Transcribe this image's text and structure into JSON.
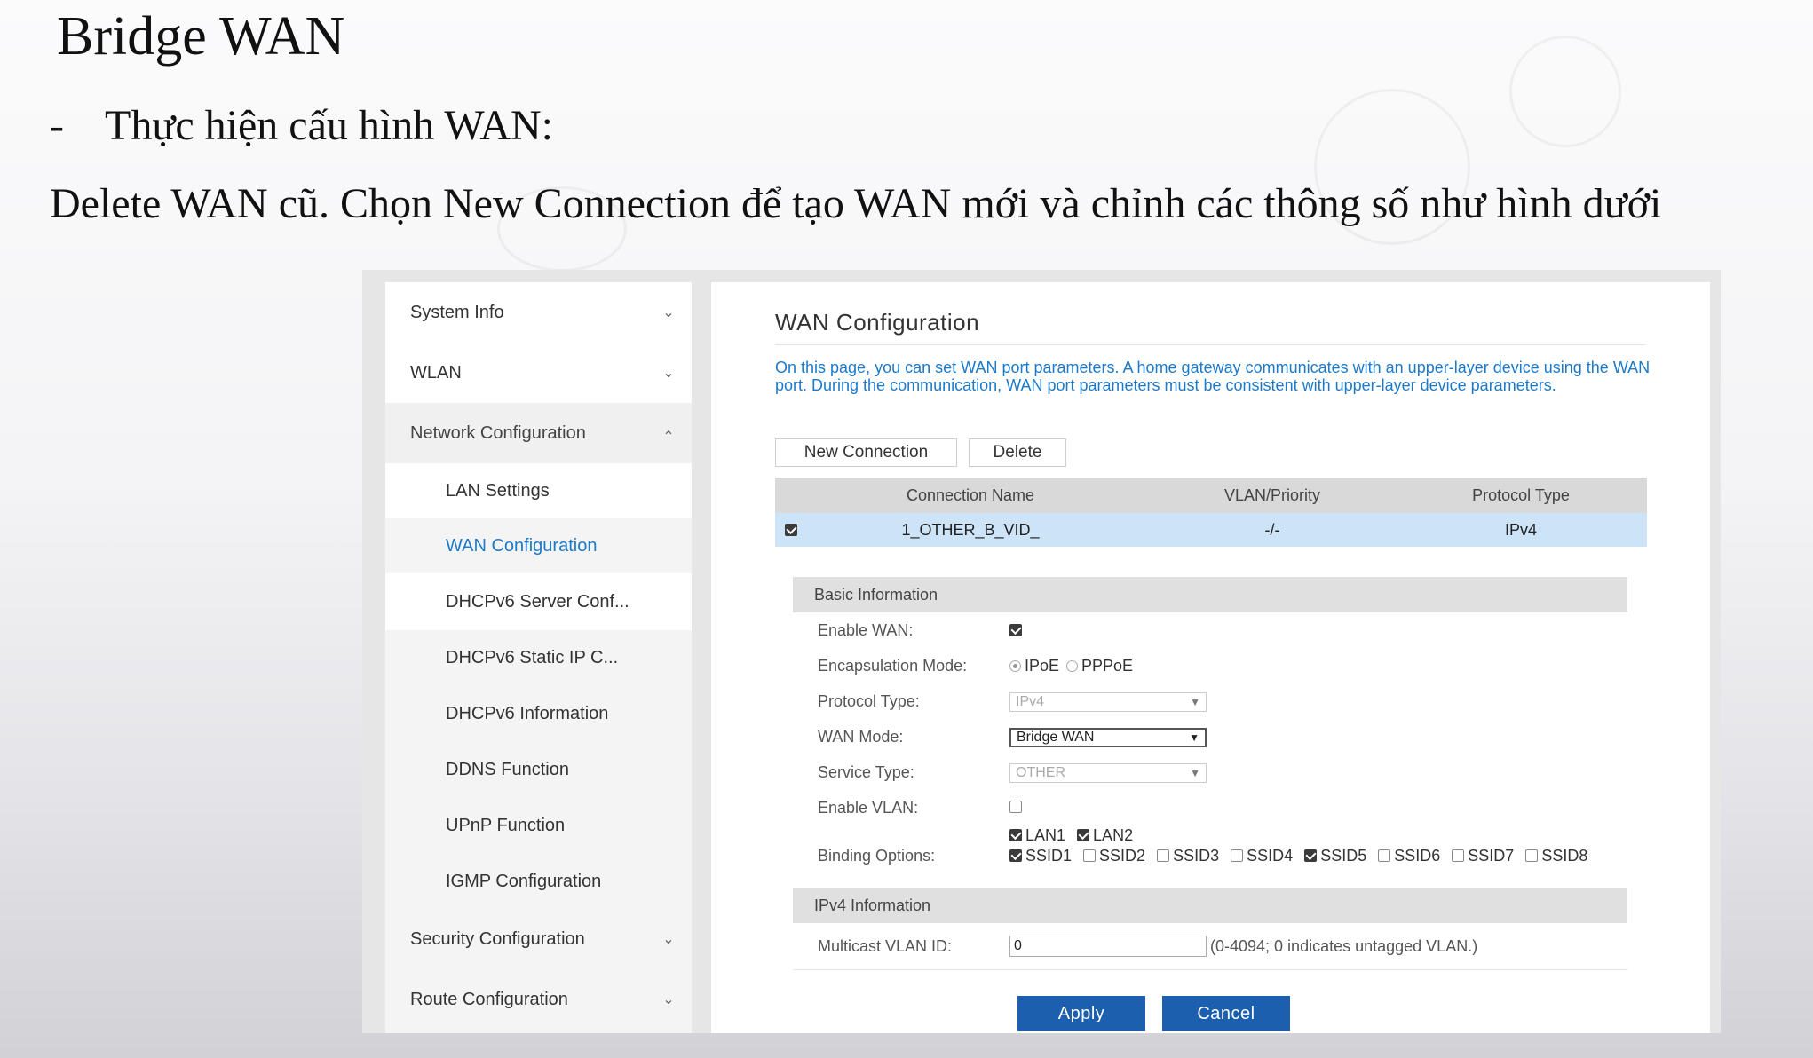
{
  "slide": {
    "title": "Bridge WAN",
    "bullet": {
      "marker": "-",
      "text": "Thực hiện cấu hình WAN:"
    },
    "description": "Delete WAN cũ. Chọn New Connection để tạo WAN mới và chỉnh các thông số như hình dưới"
  },
  "sidebar": {
    "items": [
      {
        "label": "System Info"
      },
      {
        "label": "WLAN"
      },
      {
        "label": "Network Configuration"
      },
      {
        "label": "LAN Settings"
      },
      {
        "label": "WAN Configuration"
      },
      {
        "label": "DHCPv6 Server Conf..."
      },
      {
        "label": "DHCPv6 Static IP C..."
      },
      {
        "label": "DHCPv6 Information"
      },
      {
        "label": "DDNS Function"
      },
      {
        "label": "UPnP Function"
      },
      {
        "label": "IGMP Configuration"
      },
      {
        "label": "Security Configuration"
      },
      {
        "label": "Route Configuration"
      }
    ]
  },
  "main": {
    "title": "WAN Configuration",
    "intro": "On this page, you can set WAN port parameters. A home gateway communicates with an upper-layer device using the WAN port. During the communication, WAN port parameters must be consistent with upper-layer device parameters.",
    "buttons": {
      "new_connection": "New Connection",
      "delete": "Delete"
    },
    "table": {
      "headers": [
        "Connection Name",
        "VLAN/Priority",
        "Protocol Type"
      ],
      "rows": [
        {
          "selected": true,
          "name": "1_OTHER_B_VID_",
          "vlan": "-/-",
          "protocol": "IPv4"
        }
      ]
    },
    "basic": {
      "section_title": "Basic Information",
      "enable_wan_label": "Enable WAN:",
      "enable_wan": true,
      "encap_label": "Encapsulation Mode:",
      "encap_options": [
        "IPoE",
        "PPPoE"
      ],
      "encap_selected": "IPoE",
      "protocol_label": "Protocol Type:",
      "protocol_value": "IPv4",
      "wan_mode_label": "WAN Mode:",
      "wan_mode_value": "Bridge WAN",
      "service_label": "Service Type:",
      "service_value": "OTHER",
      "enable_vlan_label": "Enable VLAN:",
      "enable_vlan": false,
      "binding_label": "Binding Options:",
      "binding": [
        {
          "name": "LAN1",
          "checked": true
        },
        {
          "name": "LAN2",
          "checked": true
        },
        {
          "name": "SSID1",
          "checked": true
        },
        {
          "name": "SSID2",
          "checked": false
        },
        {
          "name": "SSID3",
          "checked": false
        },
        {
          "name": "SSID4",
          "checked": false
        },
        {
          "name": "SSID5",
          "checked": true
        },
        {
          "name": "SSID6",
          "checked": false
        },
        {
          "name": "SSID7",
          "checked": false
        },
        {
          "name": "SSID8",
          "checked": false
        }
      ]
    },
    "ipv4": {
      "section_title": "IPv4 Information",
      "multicast_label": "Multicast VLAN ID:",
      "multicast_value": "0",
      "multicast_hint": "(0-4094; 0 indicates untagged VLAN.)"
    },
    "actions": {
      "apply": "Apply",
      "cancel": "Cancel"
    }
  }
}
